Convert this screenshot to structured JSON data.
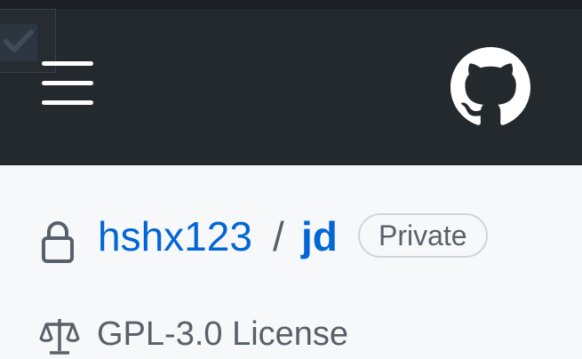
{
  "header": {
    "icons": {
      "checkbox": "check-icon",
      "menu": "hamburger-menu-icon",
      "logo": "github-mark-icon"
    },
    "colors": {
      "background": "#24292e",
      "icon": "#ffffff"
    }
  },
  "repo": {
    "owner": "hshx123",
    "separator": "/",
    "name": "jd",
    "visibility": "Private",
    "icon": "lock-icon"
  },
  "license": {
    "label": "GPL-3.0 License",
    "icon": "law-icon"
  },
  "colors": {
    "link": "#0366d6",
    "muted": "#586069",
    "page_background": "#f6f8fa",
    "badge_border": "#d1d5da"
  }
}
